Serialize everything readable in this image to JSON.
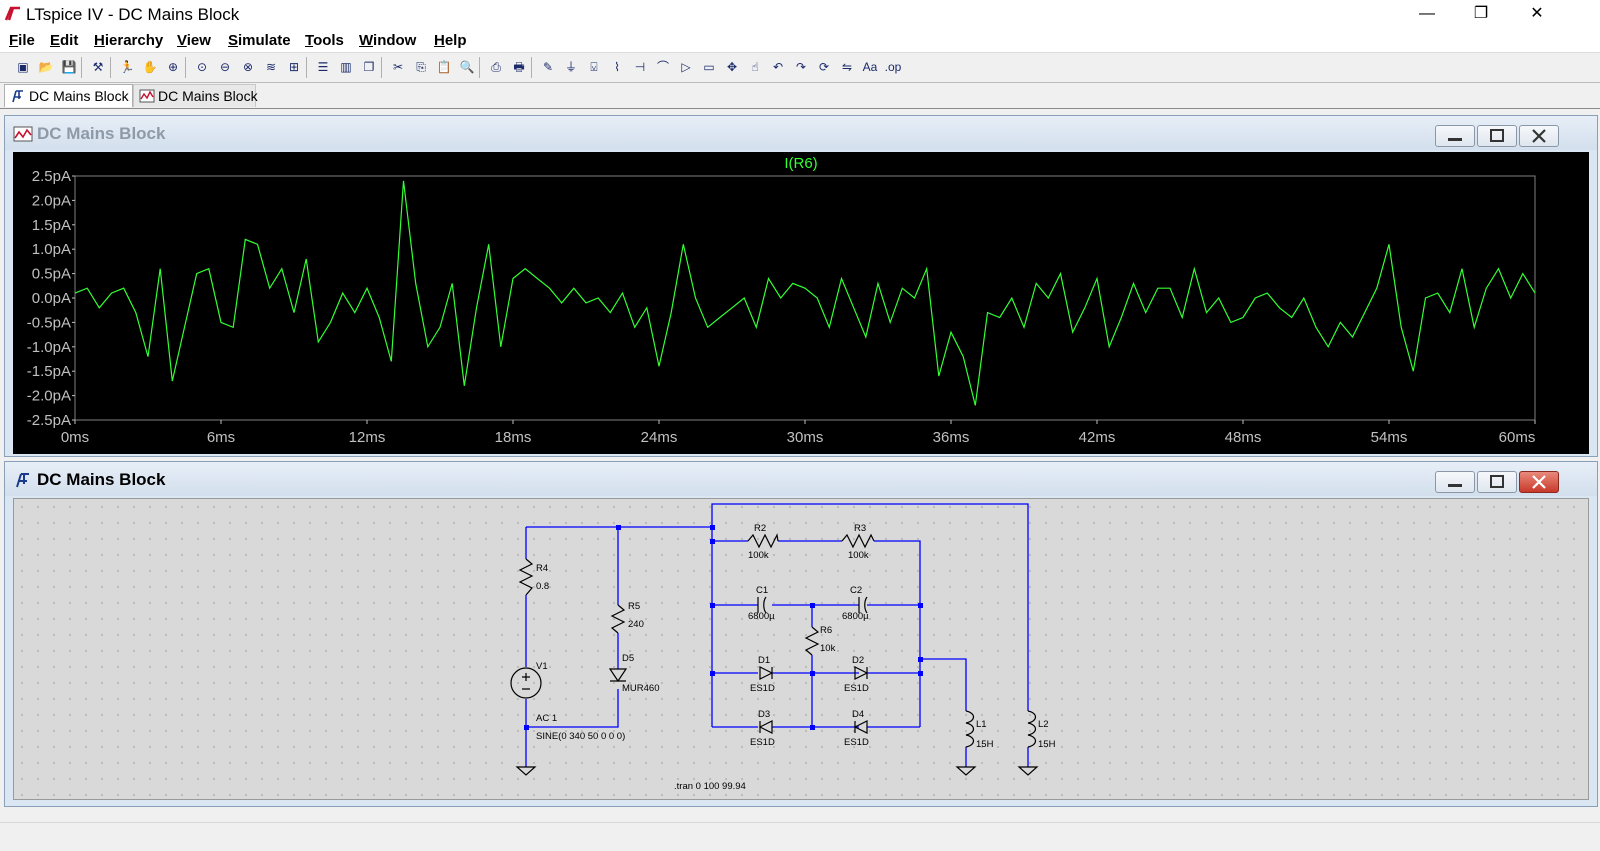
{
  "app": {
    "title": "LTspice IV - DC Mains Block",
    "window_controls": {
      "minimize": "—",
      "restore": "❐",
      "close": "✕"
    }
  },
  "menu": [
    "File",
    "Edit",
    "Hierarchy",
    "View",
    "Simulate",
    "Tools",
    "Window",
    "Help"
  ],
  "toolbar_icons": [
    "new-schematic-icon",
    "open-icon",
    "save-icon",
    "control-panel-icon",
    "run-icon",
    "halt-icon",
    "zoom-in-icon",
    "zoom-pan-icon",
    "zoom-out-icon",
    "zoom-fit-icon",
    "autorange-icon",
    "plot-settings-icon",
    "tile-horizontal-icon",
    "tile-vertical-icon",
    "cascade-icon",
    "cut-icon",
    "copy-icon",
    "paste-icon",
    "find-icon",
    "print-preview-icon",
    "print-icon",
    "draw-wire-icon",
    "ground-icon",
    "label-net-icon",
    "resistor-icon",
    "capacitor-icon",
    "inductor-icon",
    "diode-icon",
    "component-icon",
    "move-icon",
    "drag-icon",
    "undo-icon",
    "redo-icon",
    "rotate-icon",
    "mirror-icon",
    "text-icon",
    "spice-directive-icon"
  ],
  "tabs": [
    {
      "label": "DC Mains Block",
      "icon": "schematic-icon",
      "active": true
    },
    {
      "label": "DC Mains Block",
      "icon": "waveform-icon",
      "active": false
    }
  ],
  "waveform_window": {
    "title": "DC Mains Block",
    "chart_data": {
      "type": "line",
      "title": "I(R6)",
      "xlabel": "",
      "ylabel": "",
      "x_unit": "ms",
      "y_unit": "pA",
      "xlim": [
        0,
        60
      ],
      "ylim": [
        -2.5,
        2.5
      ],
      "x_ticks": [
        "0ms",
        "6ms",
        "12ms",
        "18ms",
        "24ms",
        "30ms",
        "36ms",
        "42ms",
        "48ms",
        "54ms",
        "60ms"
      ],
      "y_ticks": [
        "2.5pA",
        "2.0pA",
        "1.5pA",
        "1.0pA",
        "0.5pA",
        "0.0pA",
        "-0.5pA",
        "-1.0pA",
        "-1.5pA",
        "-2.0pA",
        "-2.5pA"
      ],
      "grid": false,
      "color": "#33ff33",
      "series": [
        {
          "name": "I(R6)",
          "x": [
            0,
            0.5,
            1,
            1.5,
            2,
            2.5,
            3,
            3.5,
            4,
            4.5,
            5,
            5.5,
            6,
            6.5,
            7,
            7.5,
            8,
            8.5,
            9,
            9.5,
            10,
            10.5,
            11,
            11.5,
            12,
            12.5,
            13,
            13.5,
            14,
            14.5,
            15,
            15.5,
            16,
            16.5,
            17,
            17.5,
            18,
            18.5,
            19,
            19.5,
            20,
            20.5,
            21,
            21.5,
            22,
            22.5,
            23,
            23.5,
            24,
            24.5,
            25,
            25.5,
            26,
            26.5,
            27,
            27.5,
            28,
            28.5,
            29,
            29.5,
            30,
            30.5,
            31,
            31.5,
            32,
            32.5,
            33,
            33.5,
            34,
            34.5,
            35,
            35.5,
            36,
            36.5,
            37,
            37.5,
            38,
            38.5,
            39,
            39.5,
            40,
            40.5,
            41,
            41.5,
            42,
            42.5,
            43,
            43.5,
            44,
            44.5,
            45,
            45.5,
            46,
            46.5,
            47,
            47.5,
            48,
            48.5,
            49,
            49.5,
            50,
            50.5,
            51,
            51.5,
            52,
            52.5,
            53,
            53.5,
            54,
            54.5,
            55,
            55.5,
            56,
            56.5,
            57,
            57.5,
            58,
            58.5,
            59,
            59.5,
            60
          ],
          "y": [
            0.1,
            0.2,
            -0.2,
            0.1,
            0.2,
            -0.3,
            -1.2,
            0.6,
            -1.7,
            -0.6,
            0.5,
            0.6,
            -0.5,
            -0.6,
            1.2,
            1.1,
            0.2,
            0.6,
            -0.3,
            0.8,
            -0.9,
            -0.5,
            0.1,
            -0.3,
            0.2,
            -0.4,
            -1.3,
            2.4,
            0.3,
            -1.0,
            -0.6,
            0.3,
            -1.8,
            -0.2,
            1.1,
            -1.0,
            0.4,
            0.6,
            0.4,
            0.2,
            -0.1,
            0.2,
            -0.1,
            0.0,
            -0.3,
            0.1,
            -0.6,
            -0.2,
            -1.4,
            -0.3,
            1.1,
            0.0,
            -0.6,
            -0.4,
            -0.2,
            0.0,
            -0.6,
            0.4,
            0.0,
            0.3,
            0.2,
            0.0,
            -0.6,
            0.4,
            -0.2,
            -0.8,
            0.3,
            -0.5,
            0.2,
            0.0,
            0.6,
            -1.6,
            -0.7,
            -1.2,
            -2.2,
            -0.3,
            -0.4,
            0.0,
            -0.6,
            0.3,
            0.0,
            0.5,
            -0.7,
            -0.2,
            0.4,
            -1.0,
            -0.4,
            0.3,
            -0.3,
            0.2,
            0.2,
            -0.4,
            0.6,
            -0.3,
            0.0,
            -0.5,
            -0.4,
            0.0,
            0.1,
            -0.2,
            -0.4,
            0.0,
            -0.6,
            -1.0,
            -0.5,
            -0.8,
            -0.3,
            0.2,
            1.1,
            -0.6,
            -1.5,
            0.0,
            0.1,
            -0.3,
            0.6,
            -0.6,
            0.2,
            0.6,
            0.0,
            0.5,
            0.1
          ]
        }
      ]
    }
  },
  "schematic_window": {
    "title": "DC Mains Block",
    "labels": {
      "r4_name": "R4",
      "r4_value": "0.8",
      "r5_name": "R5",
      "r5_value": "240",
      "d5_name": "D5",
      "d5_value": "MUR460",
      "v1_name": "V1",
      "v1_ac": "AC 1",
      "v1_value": "SINE(0 340 50 0 0 0)",
      "r2_name": "R2",
      "r2_value": "100k",
      "r3_name": "R3",
      "r3_value": "100k",
      "c1_name": "C1",
      "c1_value": "6800µ",
      "c2_name": "C2",
      "c2_value": "6800µ",
      "r6_name": "R6",
      "r6_value": "10k",
      "d1_name": "D1",
      "d1_value": "ES1D",
      "d2_name": "D2",
      "d2_value": "ES1D",
      "d3_name": "D3",
      "d3_value": "ES1D",
      "d4_name": "D4",
      "d4_value": "ES1D",
      "l1_name": "L1",
      "l1_value": "15H",
      "l2_name": "L2",
      "l2_value": "15H",
      "directive": ".tran 0 100 99.94"
    },
    "colors": {
      "wire": "#0000ff",
      "component": "#000000",
      "background": "#d9d9d9"
    }
  }
}
